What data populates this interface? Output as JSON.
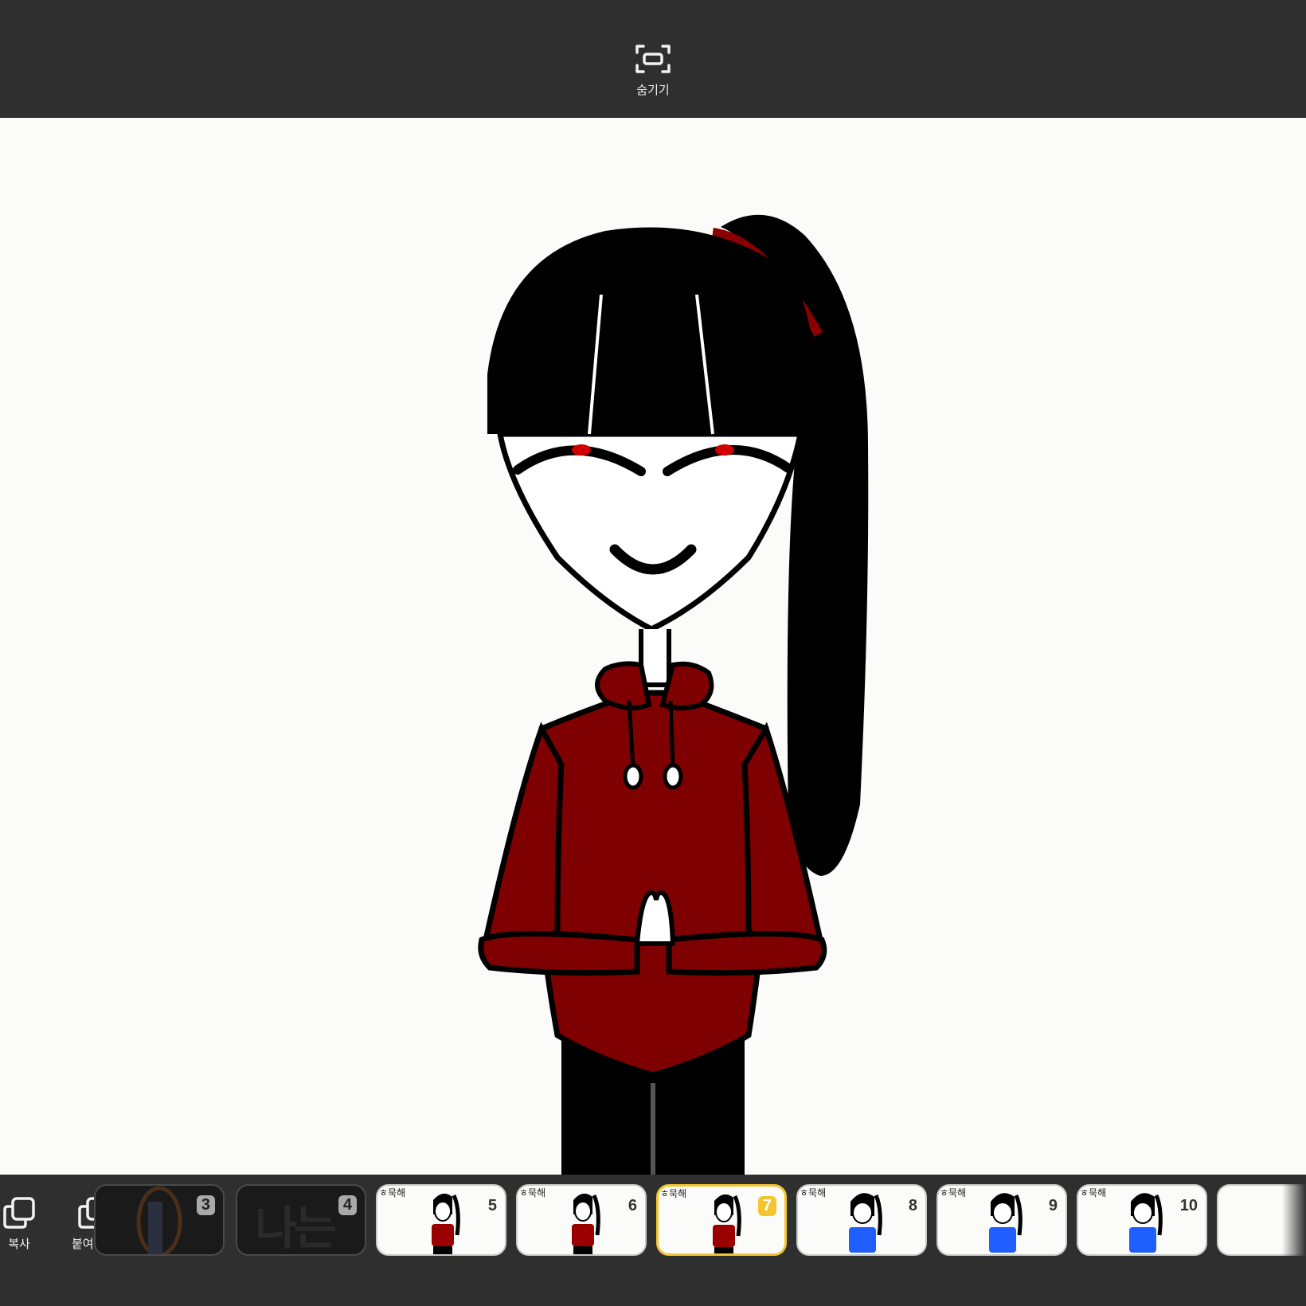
{
  "toolbar": {
    "hide_label": "숨기기"
  },
  "bottom_tools": {
    "copy_label": "복사",
    "paste_label": "붙여넣기"
  },
  "frames": [
    {
      "number": "3"
    },
    {
      "number": "4",
      "text": "나는"
    },
    {
      "number": "5",
      "caption": "ㅎ묵해"
    },
    {
      "number": "6",
      "caption": "ㅎ묵해"
    },
    {
      "number": "7",
      "caption": "ㅎ묵해"
    },
    {
      "number": "8",
      "caption": "ㅎ묵해"
    },
    {
      "number": "9",
      "caption": "ㅎ묵해"
    },
    {
      "number": "10",
      "caption": "ㅎ묵해"
    }
  ],
  "selected_frame": "7",
  "colors": {
    "chrome": "#2f2f2f",
    "canvas": "#fbfbfa",
    "selection": "#f3c52f",
    "hoodie_red": "#7e0000",
    "hoodie_blue": "#1f5fff"
  },
  "icons": {
    "hide": "hide-icon",
    "copy": "copy-icon",
    "paste": "paste-icon"
  }
}
